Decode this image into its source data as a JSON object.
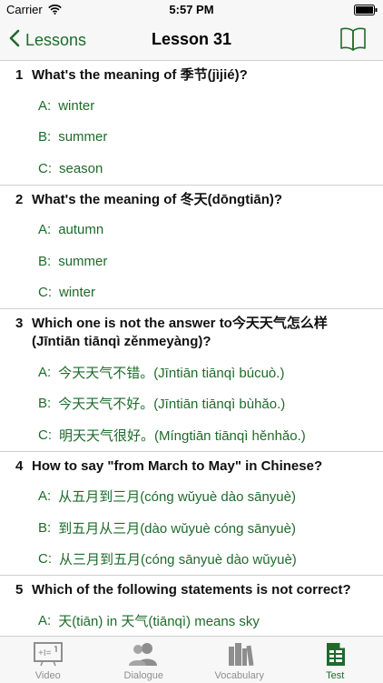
{
  "status_bar": {
    "carrier": "Carrier",
    "time": "5:57 PM"
  },
  "nav": {
    "back_label": "Lessons",
    "title": "Lesson 31"
  },
  "questions": [
    {
      "number": "1",
      "text": "What's the meaning of 季节(jìjié)?",
      "options": [
        {
          "key": "A:",
          "text": "winter"
        },
        {
          "key": "B:",
          "text": "summer"
        },
        {
          "key": "C:",
          "text": "season"
        }
      ]
    },
    {
      "number": "2",
      "text": "What's the meaning of 冬天(dōngtiān)?",
      "options": [
        {
          "key": "A:",
          "text": "autumn"
        },
        {
          "key": "B:",
          "text": "summer"
        },
        {
          "key": "C:",
          "text": "winter"
        }
      ]
    },
    {
      "number": "3",
      "text": "Which one is not the answer to今天天气怎么样(Jīntiān tiānqì zěnmeyàng)?",
      "options": [
        {
          "key": "A:",
          "text": "今天天气不错。(Jīntiān tiānqì búcuò.)"
        },
        {
          "key": "B:",
          "text": "今天天气不好。(Jīntiān tiānqì bùhǎo.)"
        },
        {
          "key": "C:",
          "text": "明天天气很好。(Míngtiān tiānqì hěnhǎo.)"
        }
      ]
    },
    {
      "number": "4",
      "text": "How to say \"from March to May\" in Chinese?",
      "options": [
        {
          "key": "A:",
          "text": "从五月到三月(cóng wǔyuè dào sānyuè)"
        },
        {
          "key": "B:",
          "text": "到五月从三月(dào wǔyuè cóng sānyuè)"
        },
        {
          "key": "C:",
          "text": "从三月到五月(cóng sānyuè dào wǔyuè)"
        }
      ]
    },
    {
      "number": "5",
      "text": "Which of the following statements is not correct?",
      "options": [
        {
          "key": "A:",
          "text": "天(tiān) in 天气(tiānqì) means sky"
        }
      ]
    }
  ],
  "tabs": [
    {
      "label": "Video",
      "icon": "video-icon"
    },
    {
      "label": "Dialogue",
      "icon": "people-icon"
    },
    {
      "label": "Vocabulary",
      "icon": "books-icon"
    },
    {
      "label": "Test",
      "icon": "test-document-icon",
      "active": true
    }
  ],
  "colors": {
    "accent": "#1e6b2a",
    "inactive": "#8e8e8e",
    "bar": "#f7f7f7"
  }
}
